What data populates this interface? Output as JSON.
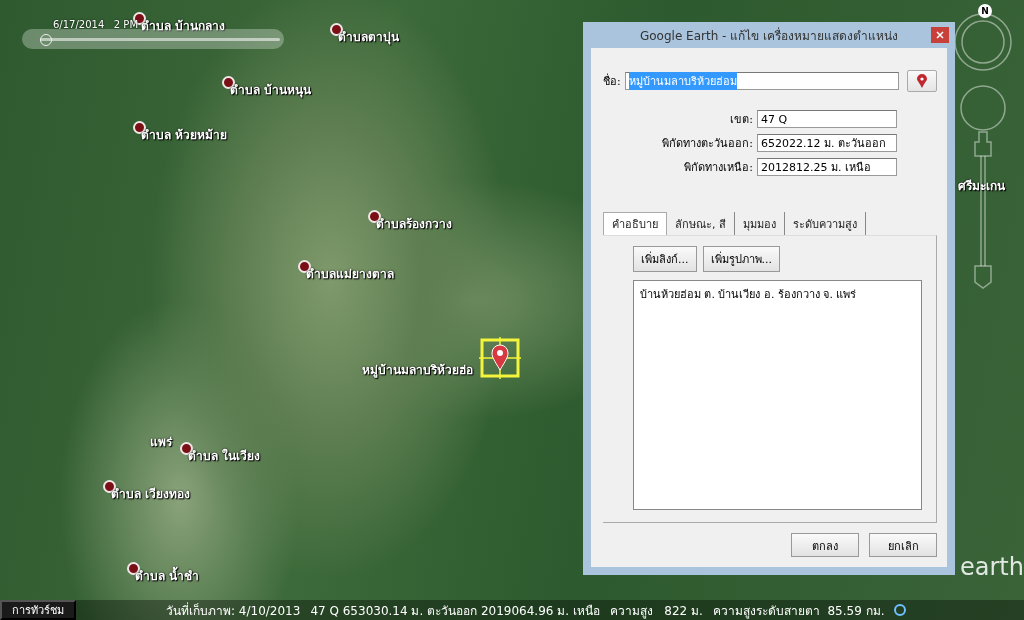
{
  "time_slider": {
    "label": "6/17/2014   2 PM",
    "level": 0.02
  },
  "places": [
    {
      "name": "ตำบล บ้านกลาง",
      "kind": "town"
    },
    {
      "name": "ตำบลตาปุน",
      "kind": "town"
    },
    {
      "name": "ตำบล บ้านหนุน",
      "kind": "town"
    },
    {
      "name": "ตำบล ห้วยหม้าย",
      "kind": "town"
    },
    {
      "name": "ศรีมะเกน",
      "kind": "label"
    },
    {
      "name": "ตำบลร้องกวาง",
      "kind": "town"
    },
    {
      "name": "ตำบลแม่ยางตาล",
      "kind": "town"
    },
    {
      "name": "หมู่บ้านมลาบริห้วยฮ่อ",
      "kind": "selected"
    },
    {
      "name": "แพร่",
      "kind": "label"
    },
    {
      "name": "ตำบล ในเวียง",
      "kind": "town"
    },
    {
      "name": "ตำบล เวียงทอง",
      "kind": "town"
    },
    {
      "name": "ตำบล น้ำชำ",
      "kind": "town"
    }
  ],
  "compass": {
    "label": "N"
  },
  "logo": {
    "text": "earth"
  },
  "dialog": {
    "title": "Google Earth - แก้ไข  เครื่องหมายแสดงตำแหน่ง",
    "name_field": {
      "label": "ชื่อ:",
      "value": "หมู่บ้านมลาบริห้วยฮ่อม",
      "highlighted": true
    },
    "coords": [
      {
        "label": "เขต:",
        "value": "47 Q"
      },
      {
        "label": "พิกัดทางตะวันออก:",
        "value": "652022.12 ม. ตะวันออก"
      },
      {
        "label": "พิกัดทางเหนือ:",
        "value": "2012812.25 ม. เหนือ"
      }
    ],
    "tabs": [
      {
        "label": "คำอธิบาย",
        "selected": true
      },
      {
        "label": "ลักษณะ, สี",
        "selected": false
      },
      {
        "label": "มุมมอง",
        "selected": false
      },
      {
        "label": "ระดับความสูง",
        "selected": false
      }
    ],
    "tool_buttons": [
      "เพิ่มลิงก์...",
      "เพิ่มรูปภาพ..."
    ],
    "description": "บ้านห้วยฮ่อม ต. บ้านเวียง อ. ร้องกวาง จ. แพร่",
    "buttons": [
      "ตกลง",
      "ยกเลิก"
    ]
  },
  "status_bar": {
    "tour": "การทัวร์ชม",
    "imagery_date": "วันที่เก็บภาพ: 4/10/2013",
    "position": "47 Q 653030.14 ม. ตะวันออก 2019064.96 ม. เหนือ",
    "elevation": "ความสูง   822 ม.",
    "eye_altitude": "ความสูงระดับสายตา  85.59 กม."
  }
}
